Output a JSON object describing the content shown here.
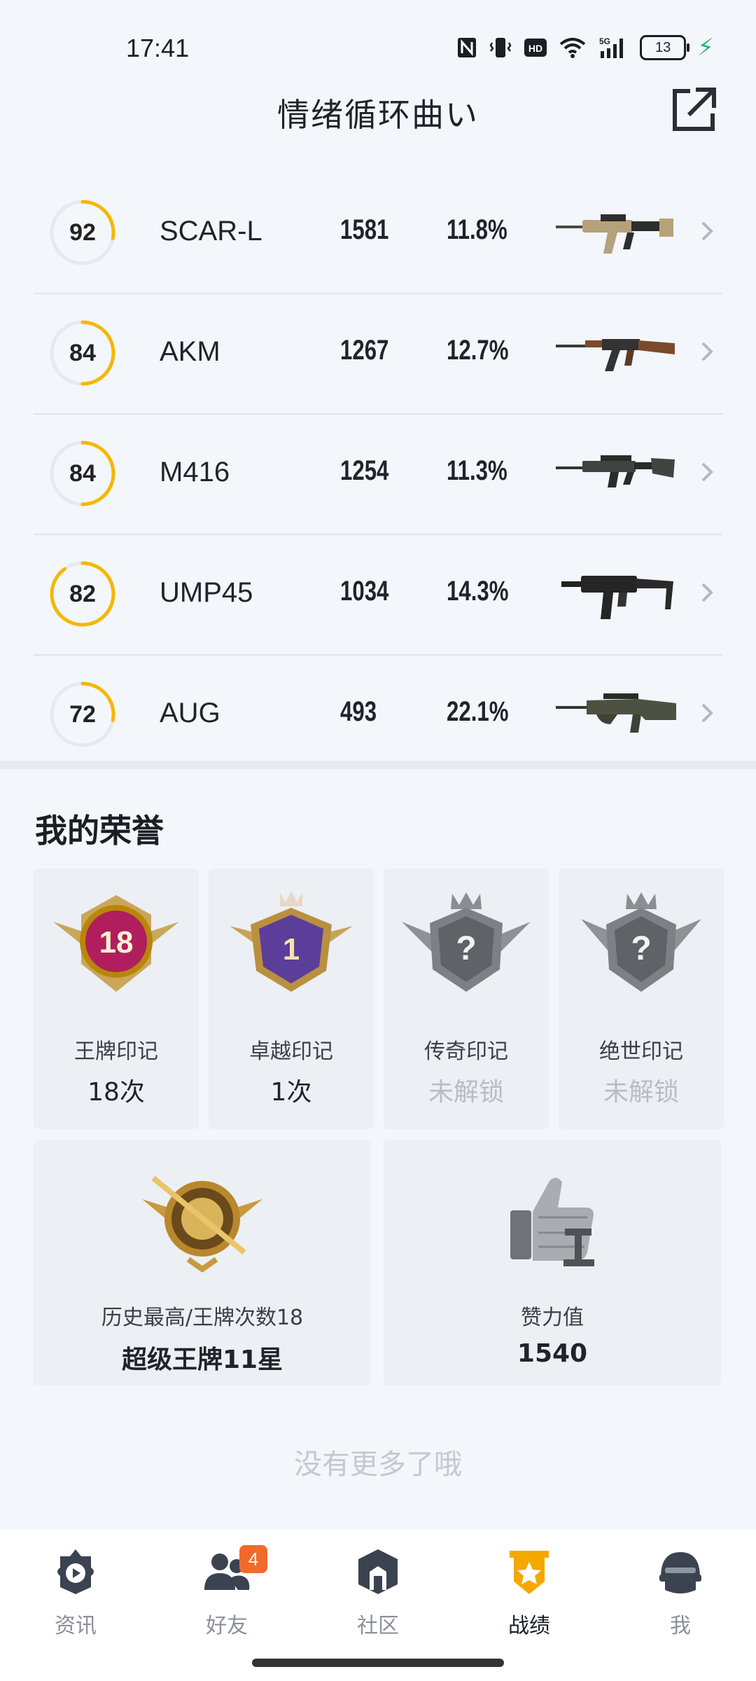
{
  "status_bar": {
    "time": "17:41",
    "icons": [
      "nfc-icon",
      "vibrate-icon",
      "hd-icon",
      "wifi-icon",
      "5g-signal-icon",
      "battery-icon",
      "charging-icon"
    ],
    "network": "5G",
    "hd": "HD",
    "battery": "13"
  },
  "header": {
    "title": "情绪循环曲い",
    "share_icon": "share-icon"
  },
  "colors": {
    "ring_progress": "#f5b800",
    "ring_track": "#e6e9ee",
    "active_tab": "#f5a800",
    "badge": "#f06a2b"
  },
  "weapons": [
    {
      "score": "92",
      "score_fraction": 0.28,
      "name": "SCAR-L",
      "kills": "1581",
      "rate": "11.8%",
      "gun_icon": "scar-l-rifle-icon"
    },
    {
      "score": "84",
      "score_fraction": 0.5,
      "name": "AKM",
      "kills": "1267",
      "rate": "12.7%",
      "gun_icon": "akm-rifle-icon"
    },
    {
      "score": "84",
      "score_fraction": 0.5,
      "name": "M416",
      "kills": "1254",
      "rate": "11.3%",
      "gun_icon": "m416-rifle-icon"
    },
    {
      "score": "82",
      "score_fraction": 0.9,
      "name": "UMP45",
      "kills": "1034",
      "rate": "14.3%",
      "gun_icon": "ump45-smg-icon"
    },
    {
      "score": "72",
      "score_fraction": 0.28,
      "name": "AUG",
      "kills": "493",
      "rate": "22.1%",
      "gun_icon": "aug-rifle-icon"
    }
  ],
  "honors": {
    "title": "我的荣誉",
    "badges": [
      {
        "label": "王牌印记",
        "value": "18次",
        "emblem_number": "18",
        "locked": false,
        "icon": "ace-emblem-icon"
      },
      {
        "label": "卓越印记",
        "value": "1次",
        "emblem_number": "1",
        "locked": false,
        "icon": "excellence-emblem-icon"
      },
      {
        "label": "传奇印记",
        "value": "未解锁",
        "emblem_number": "?",
        "locked": true,
        "icon": "legend-emblem-icon"
      },
      {
        "label": "绝世印记",
        "value": "未解锁",
        "emblem_number": "?",
        "locked": true,
        "icon": "peerless-emblem-icon"
      }
    ],
    "highest": {
      "label": "历史最高/王牌次数18",
      "value": "超级王牌11星",
      "icon": "super-ace-emblem-icon"
    },
    "likes": {
      "label": "赞力值",
      "value": "1540",
      "icon": "thumbs-up-icon"
    }
  },
  "footer_note": "没有更多了哦",
  "nav": [
    {
      "label": "资讯",
      "icon": "news-play-icon",
      "active": false
    },
    {
      "label": "好友",
      "icon": "friends-icon",
      "active": false,
      "badge": "4"
    },
    {
      "label": "社区",
      "icon": "community-icon",
      "active": false
    },
    {
      "label": "战绩",
      "icon": "stats-medal-icon",
      "active": true
    },
    {
      "label": "我",
      "icon": "helmet-icon",
      "active": false
    }
  ]
}
